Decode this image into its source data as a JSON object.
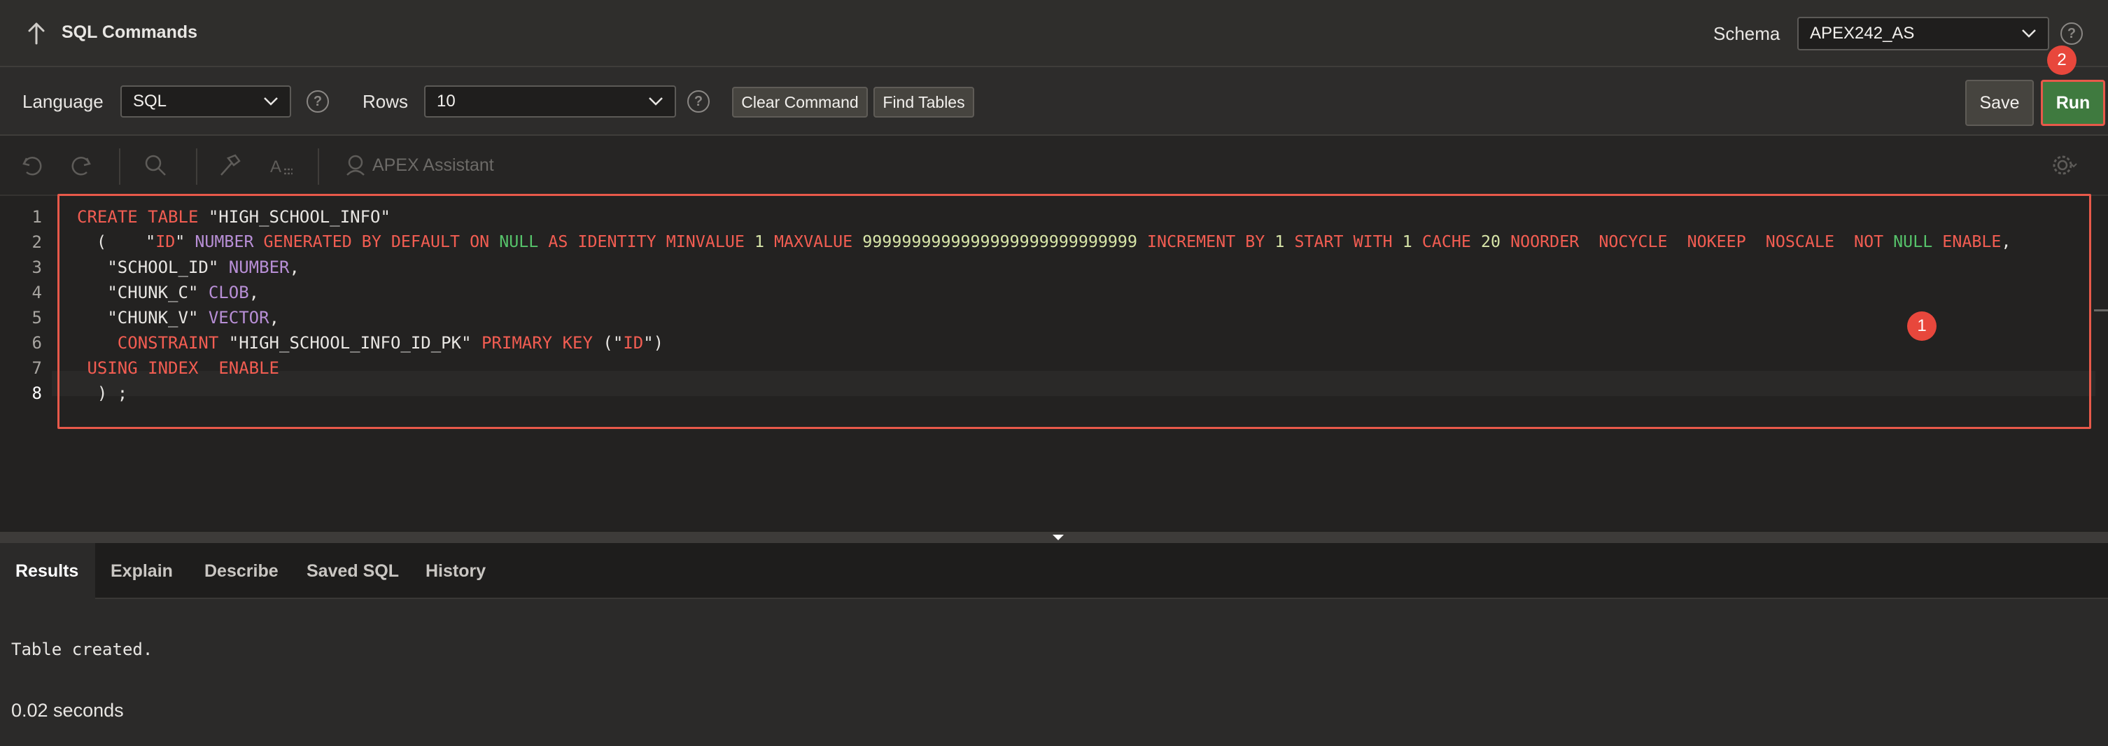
{
  "header": {
    "title": "SQL Commands",
    "schema_label": "Schema",
    "schema_value": "APEX242_AS",
    "help": "?"
  },
  "toolbar": {
    "language_label": "Language",
    "language_value": "SQL",
    "rows_label": "Rows",
    "rows_value": "10",
    "help": "?",
    "clear_label": "Clear Command",
    "find_label": "Find Tables",
    "save_label": "Save",
    "run_label": "Run"
  },
  "editor_toolbar": {
    "assistant_label": "APEX Assistant"
  },
  "annotations": {
    "badge_1": "1",
    "badge_2": "2"
  },
  "editor": {
    "line_numbers": [
      "1",
      "2",
      "3",
      "4",
      "5",
      "6",
      "7",
      "8"
    ],
    "lines": [
      "CREATE TABLE \"HIGH_SCHOOL_INFO\"",
      "  (    \"ID\" NUMBER GENERATED BY DEFAULT ON NULL AS IDENTITY MINVALUE 1 MAXVALUE 9999999999999999999999999999 INCREMENT BY 1 START WITH 1 CACHE 20 NOORDER  NOCYCLE  NOKEEP  NOSCALE  NOT NULL ENABLE,",
      "   \"SCHOOL_ID\" NUMBER,",
      "   \"CHUNK_C\" CLOB,",
      "   \"CHUNK_V\" VECTOR,",
      "    CONSTRAINT \"HIGH_SCHOOL_INFO_ID_PK\" PRIMARY KEY (\"ID\")",
      " USING INDEX  ENABLE",
      "  ) ;"
    ]
  },
  "tabs": [
    "Results",
    "Explain",
    "Describe",
    "Saved SQL",
    "History"
  ],
  "results": {
    "message": "Table created.",
    "elapsed": "0.02 seconds"
  },
  "colors": {
    "keyword": "#f25d52",
    "type": "#b88fd6",
    "null": "#56c26a",
    "number": "#d7e5a8",
    "run_button": "#3f7a3f",
    "highlight": "#e8594a"
  }
}
